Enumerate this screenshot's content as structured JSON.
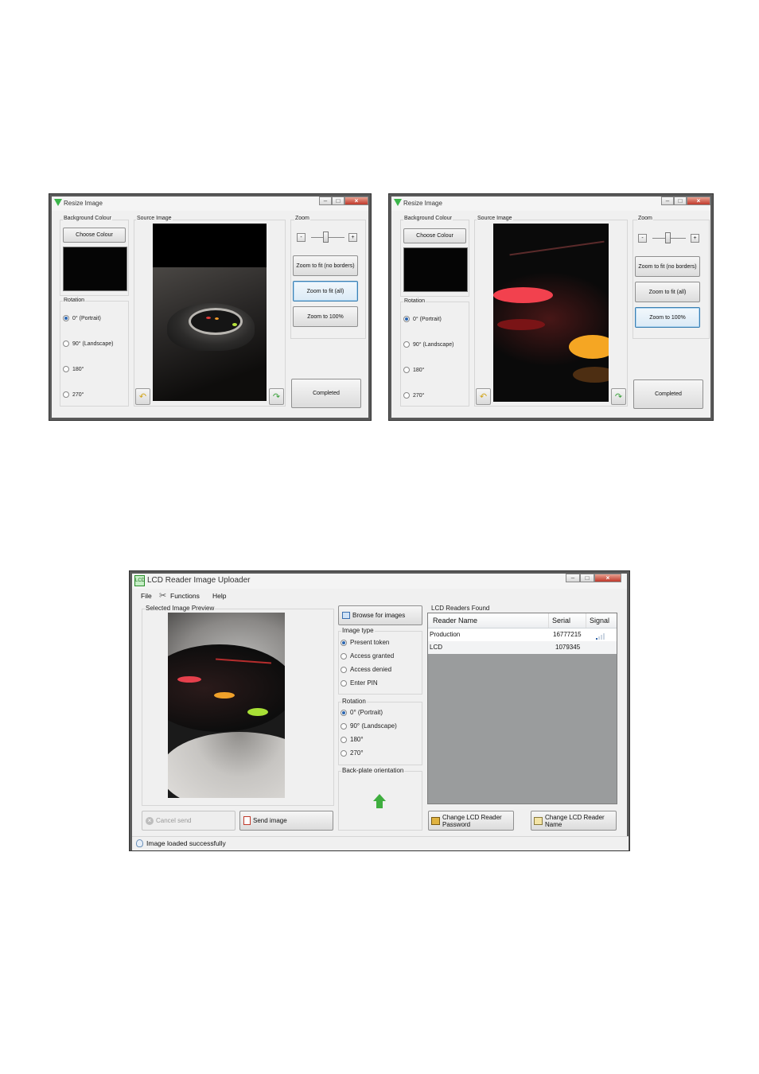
{
  "resize_window_1": {
    "title": "Resize Image",
    "background_colour_label": "Background Colour",
    "choose_colour": "Choose Colour",
    "source_image_label": "Source Image",
    "zoom_label": "Zoom",
    "zoom_minus": "-",
    "zoom_plus": "+",
    "zoom_fit_no_borders": "Zoom to fit (no borders)",
    "zoom_fit_all": "Zoom to fit (all)",
    "zoom_100": "Zoom to 100%",
    "rotation_label": "Rotation",
    "rotations": [
      "0° (Portrait)",
      "90° (Landscape)",
      "180°",
      "270°"
    ],
    "completed": "Completed"
  },
  "resize_window_2": {
    "title": "Resize Image",
    "background_colour_label": "Background Colour",
    "choose_colour": "Choose Colour",
    "source_image_label": "Source Image",
    "zoom_label": "Zoom",
    "zoom_minus": "-",
    "zoom_plus": "+",
    "zoom_fit_no_borders": "Zoom to fit (no borders)",
    "zoom_fit_all": "Zoom to fit (all)",
    "zoom_100": "Zoom to 100%",
    "rotation_label": "Rotation",
    "rotations": [
      "0° (Portrait)",
      "90° (Landscape)",
      "180°",
      "270°"
    ],
    "completed": "Completed"
  },
  "uploader": {
    "title": "LCD Reader Image Uploader",
    "menu": [
      "File",
      "Functions",
      "Help"
    ],
    "preview_label": "Selected Image Preview",
    "cancel_send": "Cancel send",
    "send_image": "Send image",
    "browse": "Browse for images",
    "image_type_label": "Image type",
    "image_types": [
      "Present token",
      "Access granted",
      "Access denied",
      "Enter PIN"
    ],
    "rotation_label": "Rotation",
    "rotations": [
      "0° (Portrait)",
      "90° (Landscape)",
      "180°",
      "270°"
    ],
    "backplate_label": "Back-plate orientation",
    "readers_label": "LCD Readers Found",
    "columns": [
      "Reader Name",
      "Serial",
      "Signal"
    ],
    "rows": [
      {
        "name": "Production",
        "serial": "16777215"
      },
      {
        "name": "LCD",
        "serial": "1079345"
      }
    ],
    "change_password": [
      "Change LCD Reader",
      "Password"
    ],
    "change_name": [
      "Change LCD Reader",
      "Name"
    ],
    "status": "Image loaded successfully"
  }
}
